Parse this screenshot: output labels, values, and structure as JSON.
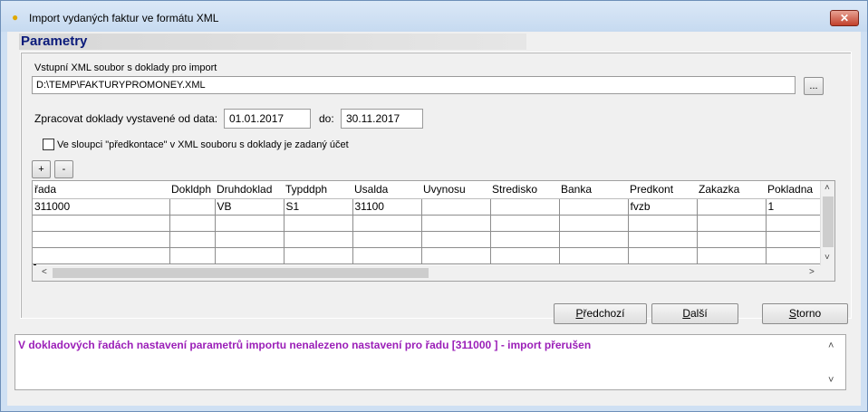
{
  "window": {
    "title": "Import vydaných faktur ve formátu XML",
    "close_symbol": "✕",
    "app_icon_glyph": "●"
  },
  "section": {
    "title": "Parametry"
  },
  "file": {
    "label": "Vstupní XML soubor s doklady pro import",
    "path": "D:\\TEMP\\FAKTURYPROMONEY.XML",
    "browse_label": "..."
  },
  "dates": {
    "from_label": "Zpracovat doklady vystavené od data:",
    "from_value": "01.01.2017",
    "to_label": "do:",
    "to_value": "30.11.2017"
  },
  "checkbox": {
    "label": "Ve sloupci \"předkontace\" v XML souboru s doklady je zadaný účet",
    "checked": false
  },
  "row_buttons": {
    "add": "+",
    "remove": "-"
  },
  "grid": {
    "columns": [
      "řada",
      "Dokldph",
      "Druhdoklad",
      "Typddph",
      "Usalda",
      "Uvynosu",
      "Stredisko",
      "Banka",
      "Predkont",
      "Zakazka",
      "Pokladna"
    ],
    "rows": [
      [
        "311000",
        "",
        "VB",
        "S1",
        "31100",
        "",
        "",
        "",
        "fvzb",
        "",
        "1"
      ],
      [
        "",
        "",
        "",
        "",
        "",
        "",
        "",
        "",
        "",
        "",
        ""
      ],
      [
        "",
        "",
        "",
        "",
        "",
        "",
        "",
        "",
        "",
        "",
        ""
      ],
      [
        "",
        "",
        "",
        "",
        "",
        "",
        "",
        "",
        "",
        "",
        ""
      ]
    ],
    "scroll_up": "˄",
    "scroll_down": "˅",
    "scroll_left": "<",
    "scroll_right": ">"
  },
  "nav": {
    "prev_mnemonic": "P",
    "prev_rest": "ředchozí",
    "next_mnemonic": "D",
    "next_rest": "alší",
    "cancel_mnemonic": "S",
    "cancel_rest": "torno"
  },
  "message": {
    "text": "V dokladových řadách nastavení parametrů importu nenalezeno nastavení pro řadu [311000    ] - import přerušen",
    "color": "#9b1fb8",
    "scroll_up": "˄",
    "scroll_down": "˅"
  },
  "colors": {
    "section_title": "#0a1a7a",
    "close_button": "#c2412b"
  }
}
